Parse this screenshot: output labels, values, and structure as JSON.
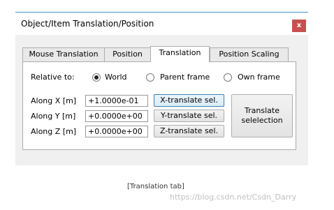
{
  "window": {
    "title": "Object/Item Translation/Position",
    "close_label": "x"
  },
  "tabs": [
    {
      "label": "Mouse Translation",
      "active": false
    },
    {
      "label": "Position",
      "active": false
    },
    {
      "label": "Translation",
      "active": true
    },
    {
      "label": "Position Scaling",
      "active": false
    }
  ],
  "relative": {
    "label": "Relative to:",
    "options": [
      {
        "label": "World",
        "checked": true
      },
      {
        "label": "Parent frame",
        "checked": false
      },
      {
        "label": "Own frame",
        "checked": false
      }
    ]
  },
  "axes": [
    {
      "label": "Along X [m]",
      "value": "+1.0000e-01",
      "button": "X-translate sel."
    },
    {
      "label": "Along Y [m]",
      "value": "+0.0000e+00",
      "button": "Y-translate sel."
    },
    {
      "label": "Along Z [m]",
      "value": "+0.0000e+00",
      "button": "Z-translate sel."
    }
  ],
  "translate_button": {
    "line1": "Translate",
    "line2": "selelection"
  },
  "caption": "[Translation tab]",
  "watermark": "https://blog.csdn.net/Csdn_Darry"
}
